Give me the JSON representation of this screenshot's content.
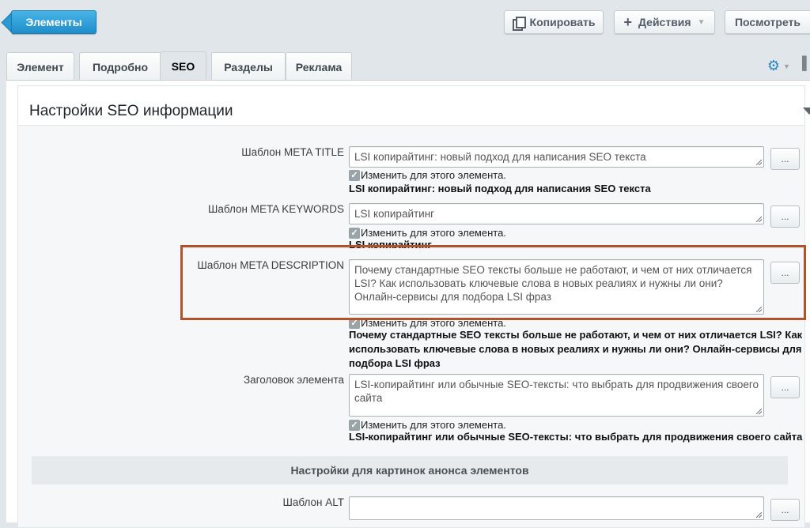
{
  "topbar": {
    "elements_label": "Элементы",
    "copy_label": "Копировать",
    "actions_label": "Действия",
    "view_label": "Посмотреть"
  },
  "tabs": [
    {
      "label": "Элемент"
    },
    {
      "label": "Подробно"
    },
    {
      "label": "SEO",
      "active": true
    },
    {
      "label": "Разделы"
    },
    {
      "label": "Реклама"
    }
  ],
  "section": {
    "title": "Настройки SEO информации"
  },
  "fields": [
    {
      "label": "Шаблон META TITLE",
      "value": "LSI копирайтинг: новый подход для написания SEO текста",
      "checkbox_label": "Изменить для этого элемента.",
      "result": "LSI копирайтинг: новый подход для написания SEO текста"
    },
    {
      "label": "Шаблон META KEYWORDS",
      "value": "LSI копирайтинг",
      "checkbox_label": "Изменить для этого элемента.",
      "result": "LSI копирайтинг"
    },
    {
      "label": "Шаблон META DESCRIPTION",
      "value": "Почему стандартные SEO тексты больше не работают, и чем от них отличается LSI? Как использовать ключевые слова в новых реалиях и нужны ли они? Онлайн-сервисы для подбора LSI фраз",
      "checkbox_label": "Изменить для этого элемента.",
      "result": "Почему стандартные SEO тексты больше не работают, и чем от них отличается LSI? Как использовать ключевые слова в новых реалиях и нужны ли они? Онлайн-сервисы для подбора LSI фраз"
    },
    {
      "label": "Заголовок элемента",
      "value": "LSI-копирайтинг или обычные SEO-тексты: что выбрать для продвижения своего сайта",
      "checkbox_label": "Изменить для этого элемента.",
      "result": "LSI-копирайтинг или обычные SEO-тексты: что выбрать для продвижения своего сайта"
    }
  ],
  "dots_label": "...",
  "subsection": {
    "title": "Настройки для картинок анонса элементов"
  },
  "alt_field": {
    "label": "Шаблон ALT",
    "value": ""
  },
  "colors": {
    "accent": "#2a9ad4",
    "highlight": "#b4532a"
  }
}
